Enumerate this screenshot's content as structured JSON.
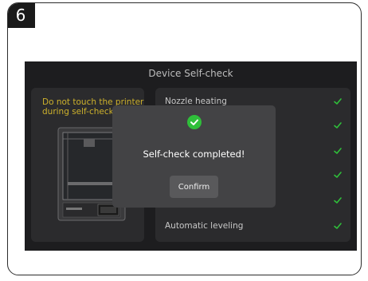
{
  "step_number": "6",
  "screen": {
    "title": "Device Self-check",
    "warning": "Do not touch the printer during self-check",
    "checks": [
      {
        "label": "Nozzle heating",
        "status": "done"
      },
      {
        "label": "",
        "status": "done"
      },
      {
        "label": "",
        "status": "done"
      },
      {
        "label": "",
        "status": "done"
      },
      {
        "label": "",
        "status": "done"
      },
      {
        "label": "Automatic leveling",
        "status": "done"
      }
    ]
  },
  "dialog": {
    "icon": "check-circle-icon",
    "message": "Self-check completed!",
    "confirm_label": "Confirm"
  },
  "colors": {
    "screen_bg": "#1d1d1f",
    "panel_bg": "#2b2b2d",
    "dialog_bg": "#434345",
    "accent_green": "#2fbf3a",
    "warning_yellow": "#cdb12c"
  }
}
